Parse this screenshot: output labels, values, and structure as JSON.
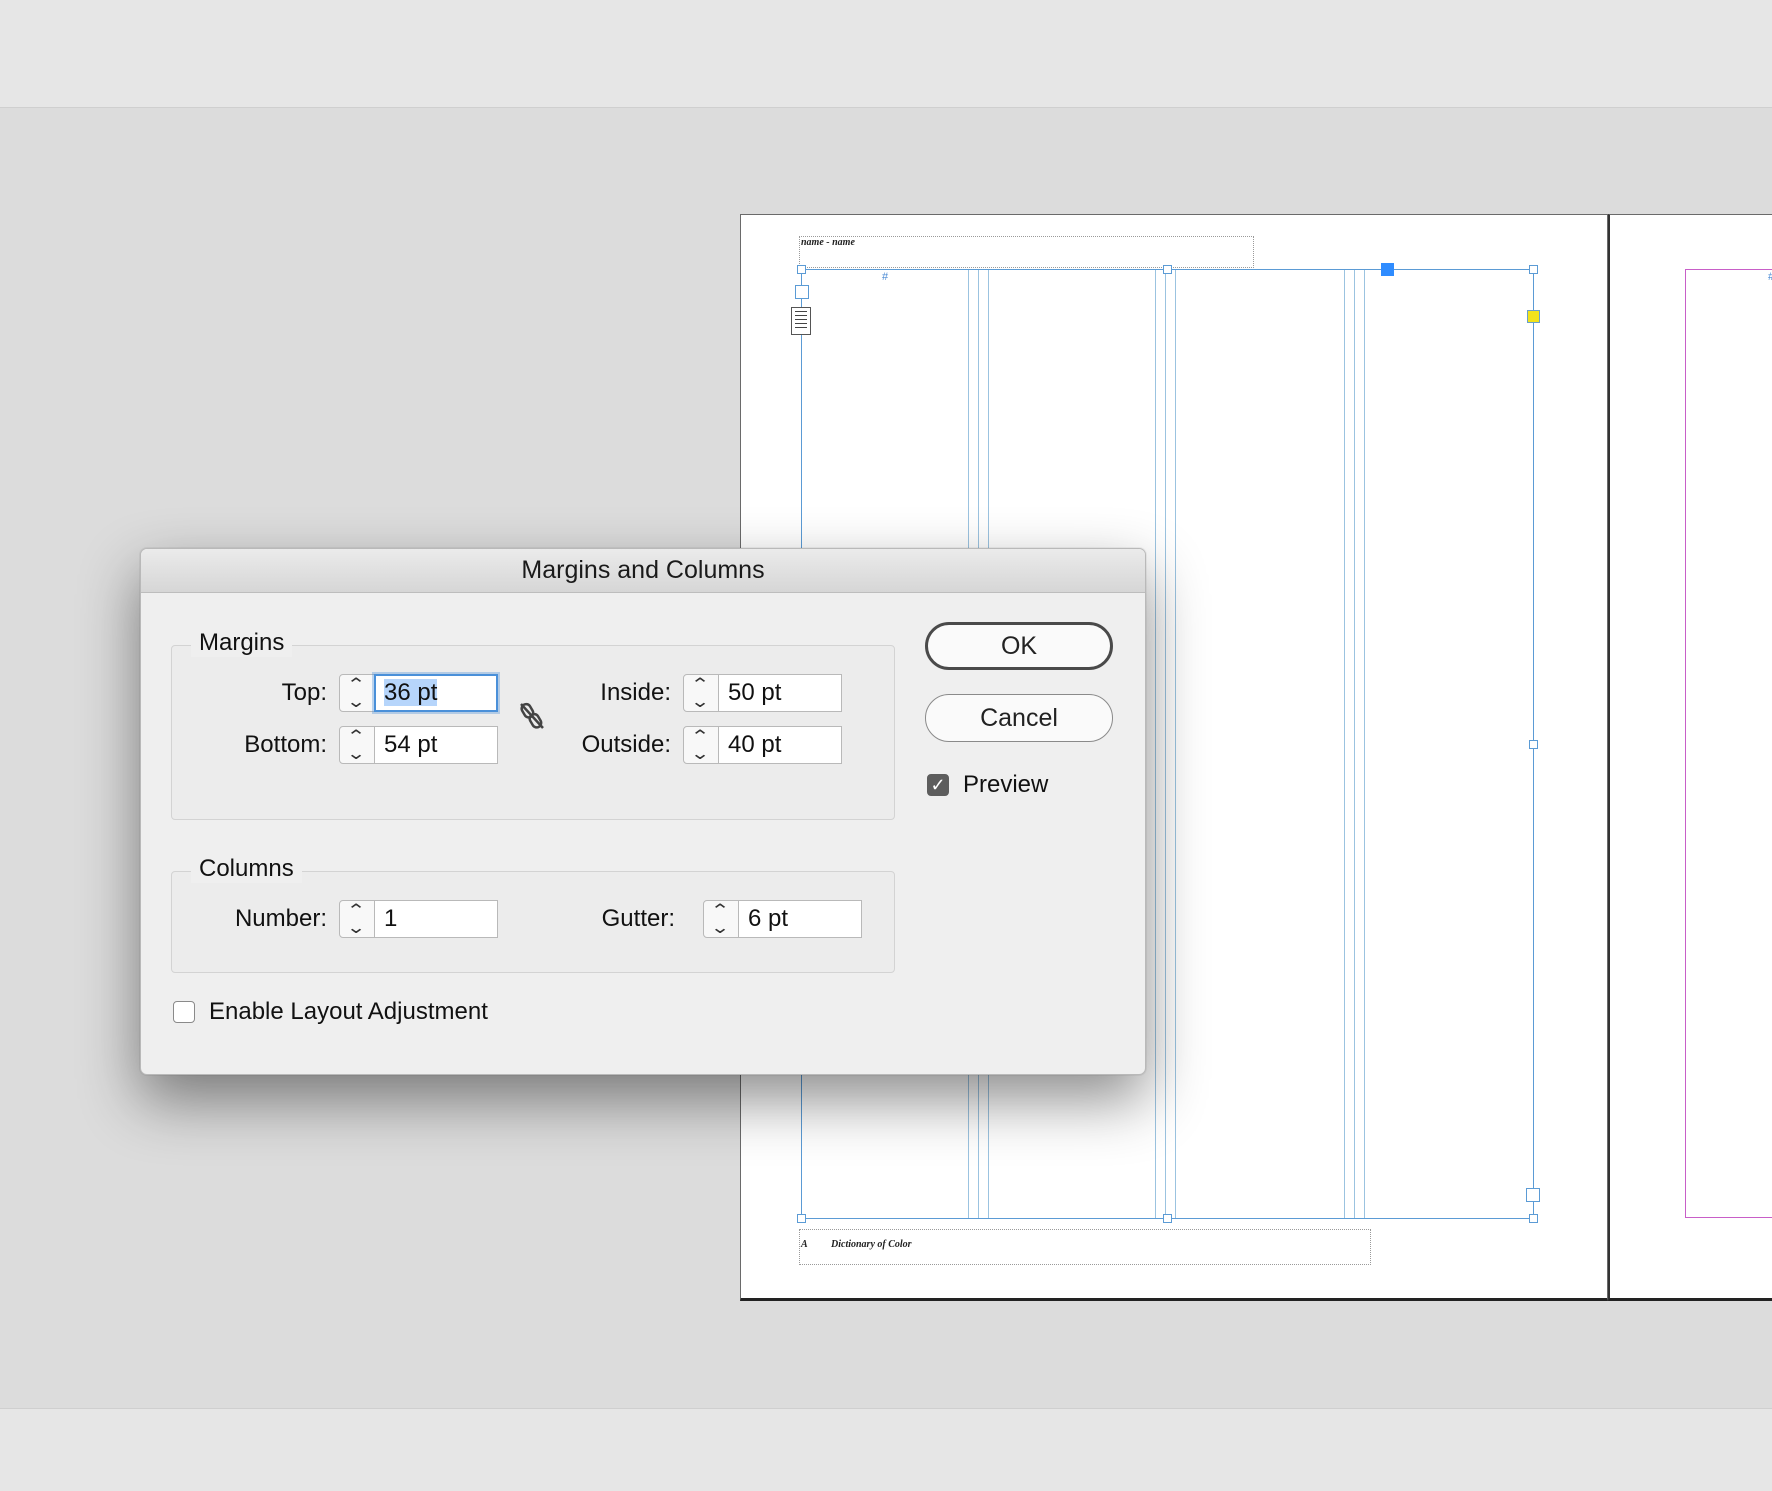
{
  "document": {
    "running_head": "name - name",
    "running_foot_a": "A",
    "running_foot_title": "Dictionary of Color",
    "page_number_marker": "#"
  },
  "dialog": {
    "title": "Margins and Columns",
    "margins": {
      "legend": "Margins",
      "top_label": "Top:",
      "top_value": "36 pt",
      "bottom_label": "Bottom:",
      "bottom_value": "54 pt",
      "inside_label": "Inside:",
      "inside_value": "50 pt",
      "outside_label": "Outside:",
      "outside_value": "40 pt",
      "link_icon": "chain-broken-icon"
    },
    "columns": {
      "legend": "Columns",
      "number_label": "Number:",
      "number_value": "1",
      "gutter_label": "Gutter:",
      "gutter_value": "6 pt"
    },
    "enable_layout_adjustment": {
      "label": "Enable Layout Adjustment",
      "checked": false
    },
    "preview": {
      "label": "Preview",
      "checked": true
    },
    "ok_label": "OK",
    "cancel_label": "Cancel"
  },
  "colors": {
    "selection_blue": "#2f8cff",
    "guide_blue": "#9bc3e0",
    "margin_magenta": "#c85ec8",
    "focus_ring": "#4a90d9"
  }
}
